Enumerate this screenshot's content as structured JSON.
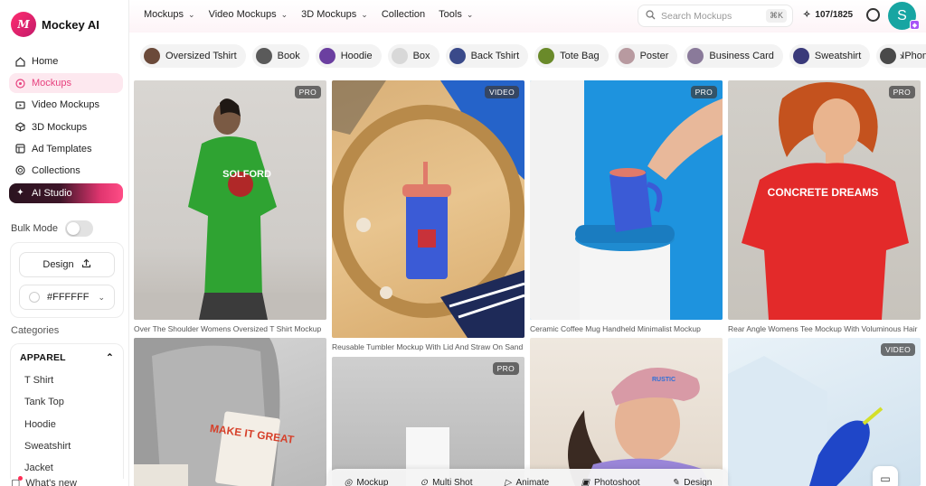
{
  "brand": {
    "logo_mark": "M",
    "name": "Mockey AI"
  },
  "sidebar": {
    "nav": [
      {
        "label": "Home",
        "icon": "home-icon"
      },
      {
        "label": "Mockups",
        "icon": "mockups-icon"
      },
      {
        "label": "Video Mockups",
        "icon": "video-icon"
      },
      {
        "label": "3D Mockups",
        "icon": "cube-icon"
      },
      {
        "label": "Ad Templates",
        "icon": "template-icon"
      },
      {
        "label": "Collections",
        "icon": "collections-icon"
      },
      {
        "label": "AI Studio",
        "icon": "sparkle-icon"
      }
    ],
    "bulk_mode_label": "Bulk Mode",
    "design_label": "Design",
    "color_value": "#FFFFFF",
    "categories_title": "Categories",
    "category_group": "APPAREL",
    "category_items": [
      "T Shirt",
      "Tank Top",
      "Hoodie",
      "Sweatshirt",
      "Jacket"
    ],
    "whats_new": "What's new"
  },
  "topbar": {
    "nav": [
      {
        "label": "Mockups",
        "dropdown": true
      },
      {
        "label": "Video Mockups",
        "dropdown": true
      },
      {
        "label": "3D Mockups",
        "dropdown": true
      },
      {
        "label": "Collection",
        "dropdown": false
      },
      {
        "label": "Tools",
        "dropdown": true
      }
    ],
    "search_placeholder": "Search Mockups",
    "search_shortcut": "⌘K",
    "credits": "107/1825",
    "avatar_letter": "S"
  },
  "chips": [
    {
      "label": "Oversized Tshirt",
      "color": "#6b4a3a"
    },
    {
      "label": "Book",
      "color": "#5a5a5a"
    },
    {
      "label": "Hoodie",
      "color": "#6b3fa0"
    },
    {
      "label": "Box",
      "color": "#d8d8d8"
    },
    {
      "label": "Back Tshirt",
      "color": "#3a4a8a"
    },
    {
      "label": "Tote Bag",
      "color": "#6a8a2a"
    },
    {
      "label": "Poster",
      "color": "#b89aa0"
    },
    {
      "label": "Business Card",
      "color": "#8a7a9a"
    },
    {
      "label": "Sweatshirt",
      "color": "#3a3a7a"
    },
    {
      "label": "IPhone",
      "color": "#4a4a4a"
    }
  ],
  "cards": [
    {
      "badge": "PRO",
      "caption": "Over The Shoulder Womens Oversized T Shirt Mockup"
    },
    {
      "badge": "VIDEO",
      "caption": "Reusable Tumbler Mockup With Lid And Straw On Sand"
    },
    {
      "badge": "PRO",
      "caption": "Ceramic Coffee Mug Handheld Minimalist Mockup"
    },
    {
      "badge": "PRO",
      "caption": "Rear Angle Womens Tee Mockup With Voluminous Hair"
    },
    {
      "badge": "",
      "caption": ""
    },
    {
      "badge": "PRO",
      "caption": ""
    },
    {
      "badge": "",
      "caption": ""
    },
    {
      "badge": "VIDEO",
      "caption": ""
    }
  ],
  "card_art": {
    "tee_front_text": "SOLFORD",
    "tee_back_text": "CONCRETE DREAMS",
    "book_text": "MAKE IT GREAT",
    "cap_text": "RUSTIC"
  },
  "bottom_bar": [
    "Mockup",
    "Multi Shot",
    "Animate",
    "Photoshoot",
    "Design"
  ],
  "colors": {
    "accent": "#e7417e",
    "avatar": "#17a5a2"
  }
}
